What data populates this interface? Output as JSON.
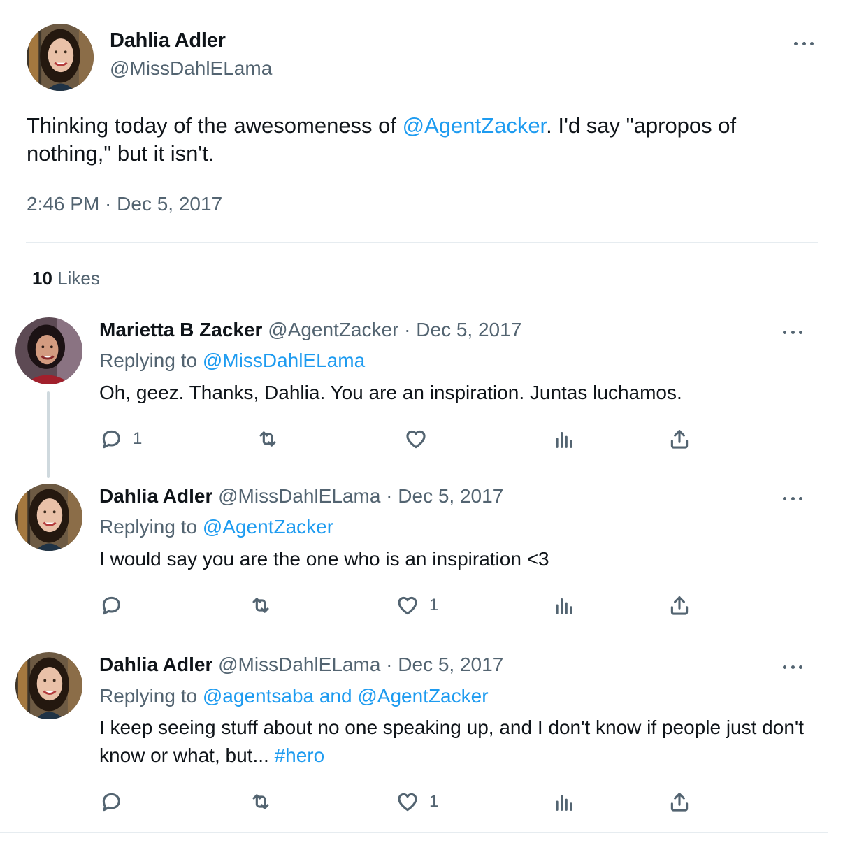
{
  "main_tweet": {
    "author_name": "Dahlia Adler",
    "author_handle": "@MissDahlELama",
    "text_part1": "Thinking today of the awesomeness of ",
    "mention": "@AgentZacker",
    "text_part2": ". I'd say \"apropos of nothing,\" but it isn't.",
    "timestamp": "2:46 PM · Dec 5, 2017",
    "likes_count": "10",
    "likes_label": "Likes"
  },
  "replies": [
    {
      "author_name": "Marietta B Zacker",
      "meta": "@AgentZacker · Dec 5, 2017",
      "replying_label": "Replying to ",
      "replying_to": "@MissDahlELama",
      "text": "Oh, geez. Thanks, Dahlia. You are an inspiration. Juntas luchamos.",
      "reply_count": "1",
      "retweet_count": "",
      "like_count": ""
    },
    {
      "author_name": "Dahlia Adler",
      "meta": "@MissDahlELama · Dec 5, 2017",
      "replying_label": "Replying to ",
      "replying_to": "@AgentZacker",
      "text": "I would say you are the one who is an inspiration <3",
      "reply_count": "",
      "retweet_count": "",
      "like_count": "1"
    },
    {
      "author_name": "Dahlia Adler",
      "meta": "@MissDahlELama · Dec 5, 2017",
      "replying_label": "Replying to ",
      "replying_to": "@agentsaba and @AgentZacker",
      "text": "I keep seeing stuff about no one speaking up, and I don't know if people just don't know or what, but... ",
      "hashtag": "#hero",
      "reply_count": "",
      "retweet_count": "",
      "like_count": "1"
    }
  ],
  "colors": {
    "link": "#1d9bf0",
    "secondary_text": "#536471",
    "primary_text": "#0f1419",
    "divider": "#e6ecf0"
  },
  "icons": [
    "more-icon",
    "reply-icon",
    "retweet-icon",
    "like-icon",
    "views-icon",
    "share-icon"
  ]
}
